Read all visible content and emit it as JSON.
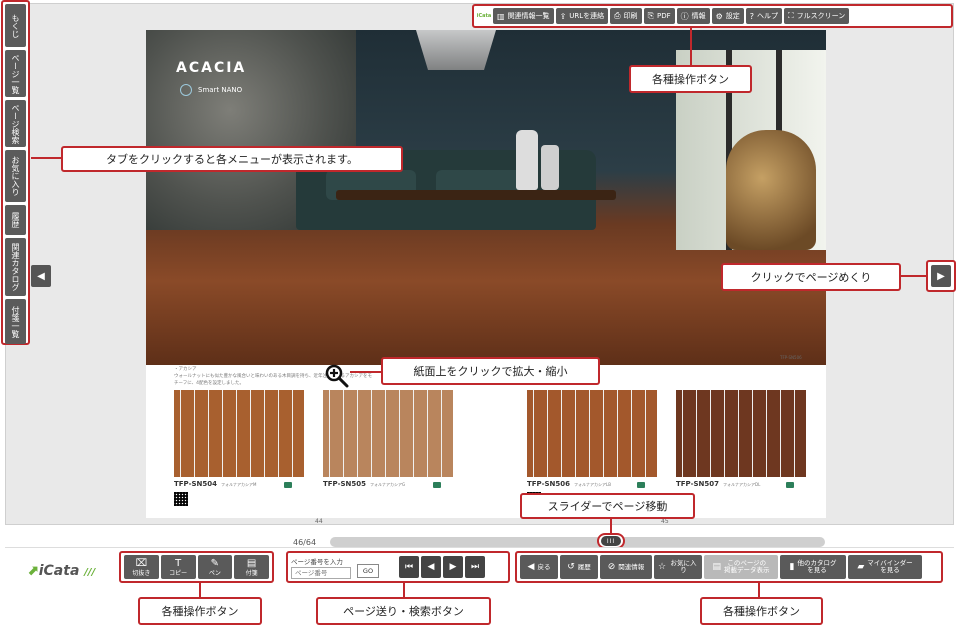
{
  "side_tabs": [
    "もくじ",
    "ページ一覧",
    "ページ検索",
    "お気に入り",
    "履歴",
    "関連カタログ",
    "付箋一覧"
  ],
  "top_toolbar": {
    "logo": "iCata",
    "buttons": [
      {
        "label": "関連情報一覧",
        "icon": "▥"
      },
      {
        "label": "URLを連絡",
        "icon": "⇪"
      },
      {
        "label": "印刷",
        "icon": "⎙"
      },
      {
        "label": "PDF",
        "icon": "⎘"
      },
      {
        "label": "情報",
        "icon": "ⓘ"
      },
      {
        "label": "設定",
        "icon": "⚙"
      },
      {
        "label": "ヘルプ",
        "icon": "?"
      },
      {
        "label": "フルスクリーン",
        "icon": "⛶"
      }
    ]
  },
  "catalog": {
    "title": "ACACIA",
    "subtitle": "Smart NANO",
    "photo_code": "TFP-SN506",
    "description": "・アカシア\nウォールナットにも似た豊かな風合いと味わいのある木目調を持ち、近年注目されるアカシアをモチーフに、4配色を設定しました。",
    "swatches": [
      {
        "code": "TFP-SN504",
        "name": "フォルナアカシアM",
        "color": "#a8602f"
      },
      {
        "code": "TFP-SN505",
        "name": "フォルナアカシアG",
        "color": "#b9855d"
      },
      {
        "code": "TFP-SN506",
        "name": "フォルナアカシアLB",
        "color": "#a3582c"
      },
      {
        "code": "TFP-SN507",
        "name": "フォルナアカシアDL",
        "color": "#6e3720"
      }
    ],
    "left_page_num": "44",
    "right_page_num": "45"
  },
  "slider": {
    "count": "46/64",
    "knob": "III"
  },
  "callouts": {
    "top_toolbar": "各種操作ボタン",
    "tabs": "タブをクリックすると各メニューが表示されます。",
    "page_turn": "クリックでページめくり",
    "zoom": "紙面上をクリックで拡大・縮小",
    "slider": "スライダーでページ移動",
    "bottom_left": "各種操作ボタン",
    "bottom_center": "ページ送り・検索ボタン",
    "bottom_right": "各種操作ボタン"
  },
  "bottom": {
    "logo": "iCata",
    "tools": [
      {
        "label": "切抜き",
        "icon": "⌧"
      },
      {
        "label": "コピー",
        "icon": "T"
      },
      {
        "label": "ペン",
        "icon": "✎"
      },
      {
        "label": "付箋",
        "icon": "▤"
      }
    ],
    "page_input_label": "ページ番号を入力",
    "page_input_placeholder": "ページ番号",
    "go_label": "GO",
    "actions": [
      {
        "label": "戻る",
        "icon": "◀"
      },
      {
        "label": "履歴",
        "icon": "↺"
      },
      {
        "label": "関連情報",
        "icon": "⊘"
      },
      {
        "label": "お気に入り",
        "icon": "☆"
      },
      {
        "label": "このページの\n掲載データ表示",
        "icon": "▤",
        "light": true
      },
      {
        "label": "他のカタログ\nを見る",
        "icon": "▮"
      },
      {
        "label": "マイバインダー\nを見る",
        "icon": "▰"
      }
    ]
  }
}
